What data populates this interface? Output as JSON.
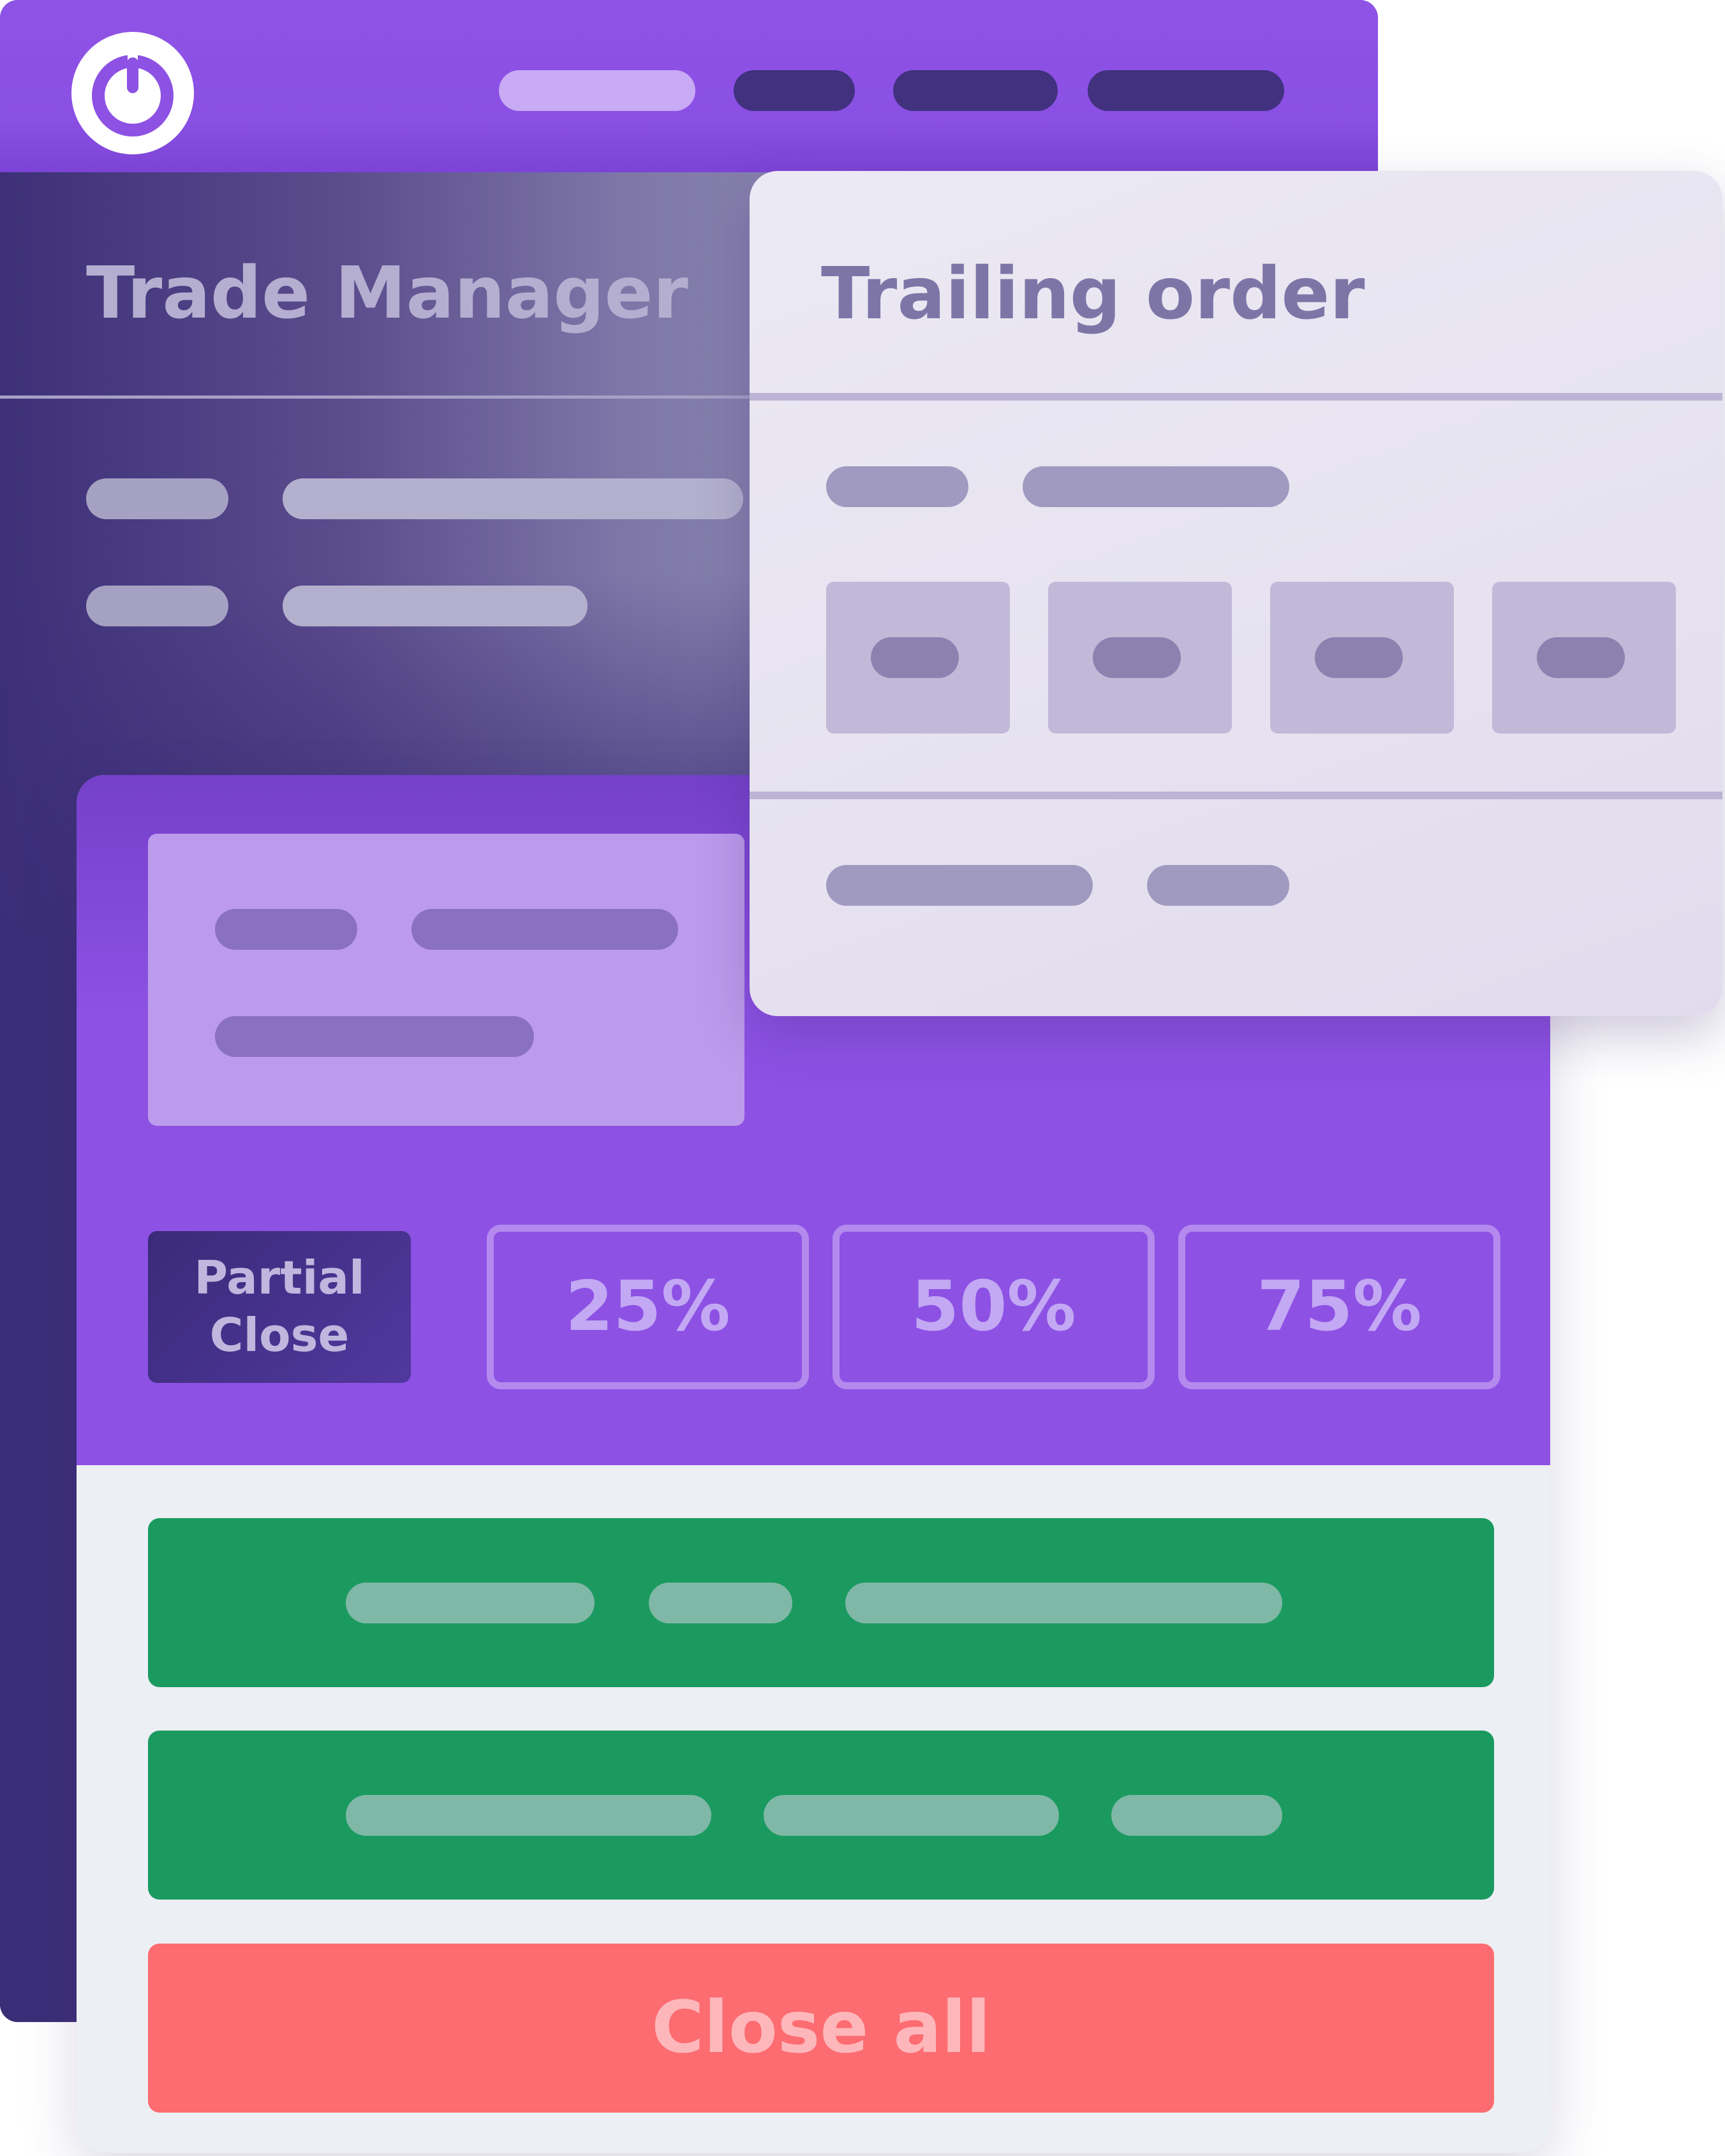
{
  "back_window": {
    "title": "Trade Manager"
  },
  "trailing_panel": {
    "title": "Trailing order"
  },
  "front_panel": {
    "partial_close_label": "Partial Close",
    "percent_buttons": [
      "25%",
      "50%",
      "75%"
    ],
    "close_all_label": "Close all"
  },
  "colors": {
    "purple_accent": "#8d51e4",
    "dark_indigo": "#3b2e78",
    "green_action": "#1b9a60",
    "close_all_red": "#fc6c70"
  }
}
